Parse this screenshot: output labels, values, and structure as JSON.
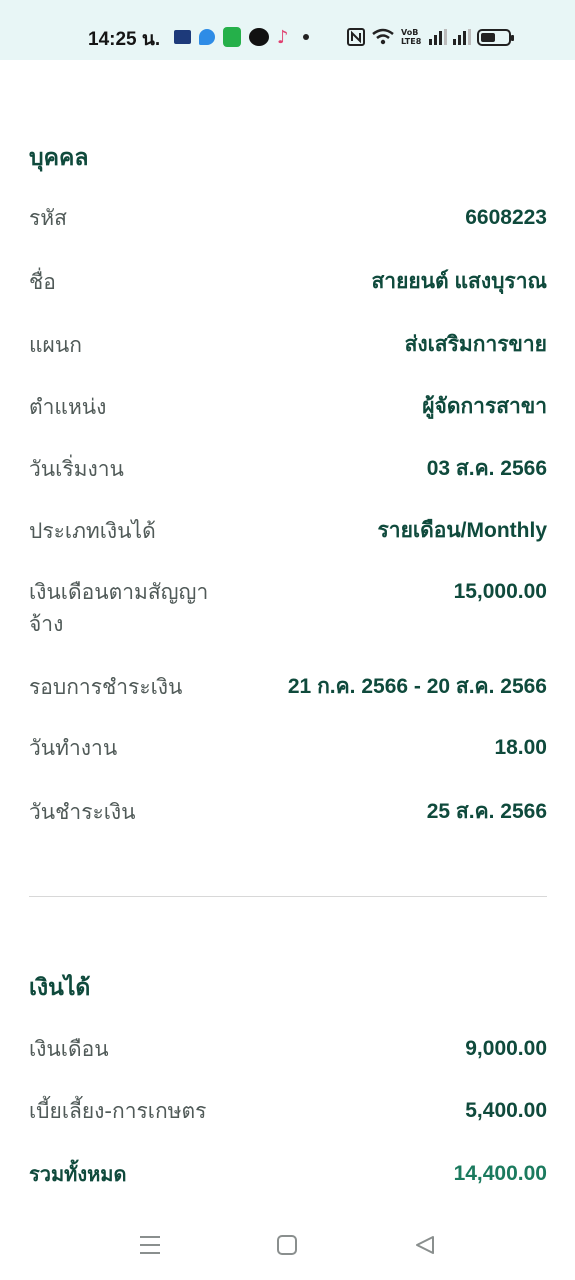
{
  "status_bar": {
    "time": "14:25 น.",
    "icons": [
      "news-app-icon",
      "blue-app-icon",
      "green-app-icon",
      "line-app-icon",
      "tiktok-icon",
      "notification-dot-icon",
      "nfc-icon",
      "wifi-icon",
      "volte-icon",
      "signal-icon",
      "signal-icon",
      "battery-icon"
    ],
    "volte_text": "VoB LTE8"
  },
  "person_section": {
    "title": "บุคคล",
    "rows": [
      {
        "label": "รหัส",
        "value": "6608223"
      },
      {
        "label": "ชื่อ",
        "value": "สายยนต์ แสงบุราณ"
      },
      {
        "label": "แผนก",
        "value": "ส่งเสริมการขาย"
      },
      {
        "label": "ตำแหน่ง",
        "value": "ผู้จัดการสาขา"
      },
      {
        "label": "วันเริ่มงาน",
        "value": "03 ส.ค. 2566"
      },
      {
        "label": "ประเภทเงินได้",
        "value": "รายเดือน/Monthly"
      },
      {
        "label": "เงินเดือนตามสัญญาจ้าง",
        "value": "15,000.00"
      },
      {
        "label": "รอบการชำระเงิน",
        "value": "21 ก.ค. 2566 - 20 ส.ค. 2566"
      },
      {
        "label": "วันทำงาน",
        "value": "18.00"
      },
      {
        "label": "วันชำระเงิน",
        "value": "25 ส.ค. 2566"
      }
    ]
  },
  "income_section": {
    "title": "เงินได้",
    "rows": [
      {
        "label": "เงินเดือน",
        "value": "9,000.00"
      },
      {
        "label": "เบี้ยเลี้ยง-การเกษตร",
        "value": "5,400.00"
      }
    ],
    "total_label": "รวมทั้งหมด",
    "total_value": "14,400.00"
  },
  "colors": {
    "accent": "#0f4a3c",
    "total": "#1b7a5e",
    "label": "#505a58",
    "status_bg": "#e8f6f6"
  }
}
